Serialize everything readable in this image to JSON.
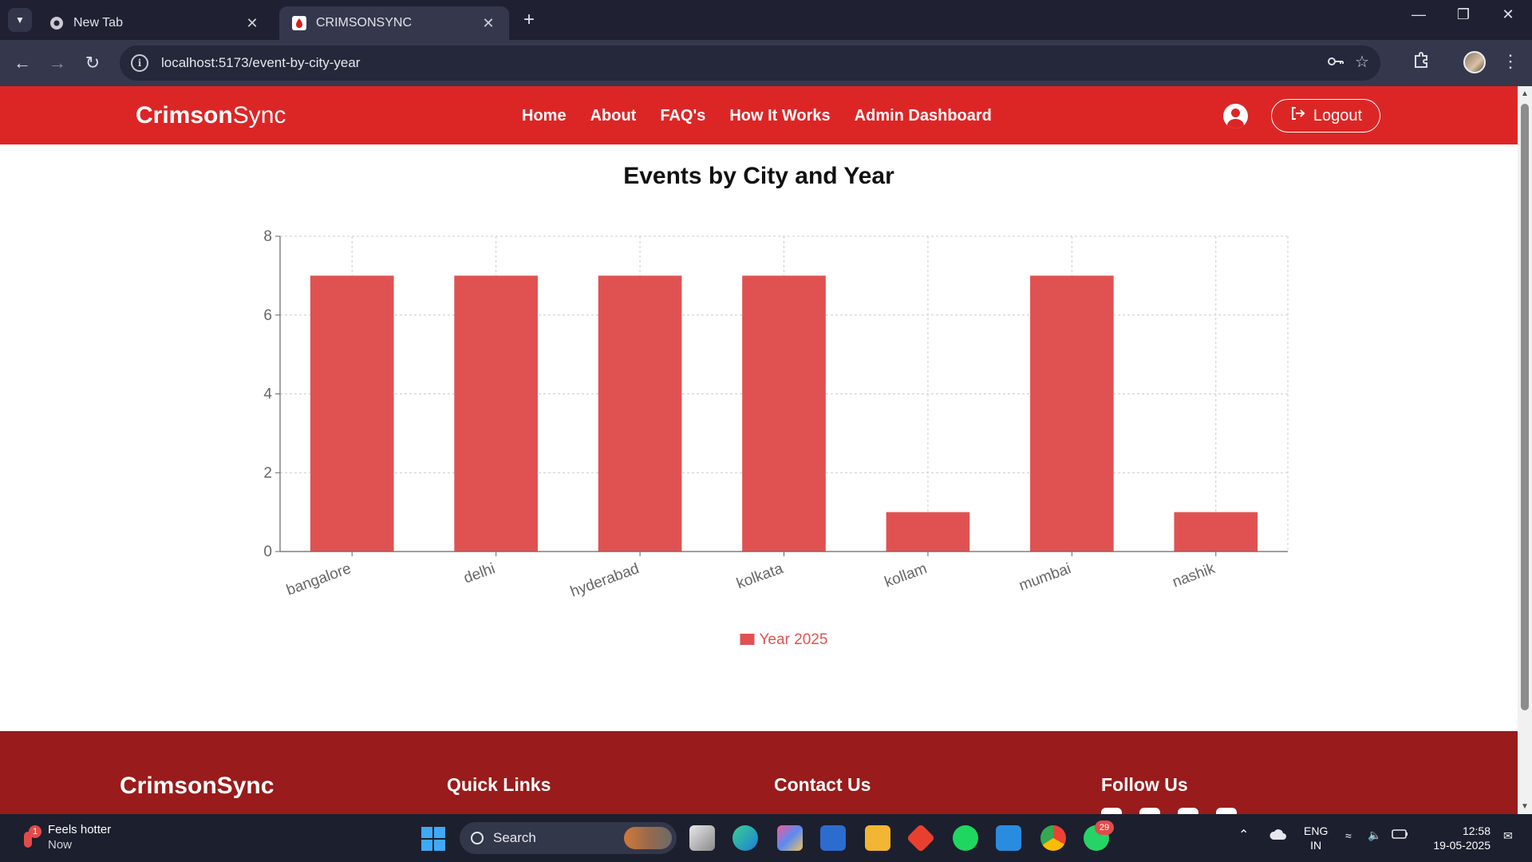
{
  "browser": {
    "tabs": [
      {
        "title": "New Tab",
        "icon": "chrome-icon",
        "active": false
      },
      {
        "title": "CRIMSONSYNC",
        "icon": "blood-drop-icon",
        "active": true
      }
    ],
    "url": "localhost:5173/event-by-city-year"
  },
  "header": {
    "brand_bold": "Crimson",
    "brand_light": "Sync",
    "nav": [
      "Home",
      "About",
      "FAQ's",
      "How It Works",
      "Admin Dashboard"
    ],
    "logout_label": "Logout"
  },
  "page": {
    "title": "Events by City and Year"
  },
  "chart_data": {
    "type": "bar",
    "categories": [
      "bangalore",
      "delhi",
      "hyderabad",
      "kolkata",
      "kollam",
      "mumbai",
      "nashik"
    ],
    "series": [
      {
        "name": "Year 2025",
        "values": [
          7,
          7,
          7,
          7,
          1,
          7,
          1
        ],
        "color": "#e05252"
      }
    ],
    "ylim": [
      0,
      8
    ],
    "yticks": [
      0,
      2,
      4,
      6,
      8
    ],
    "grid": true,
    "legend": "bottom-center",
    "xlabel": "",
    "ylabel": ""
  },
  "footer": {
    "brand": "CrimsonSync",
    "headings": [
      "Quick Links",
      "Contact Us",
      "Follow Us"
    ]
  },
  "taskbar": {
    "weather_title": "Feels hotter",
    "weather_sub": "Now",
    "weather_badge": "1",
    "search_label": "Search",
    "whatsapp_badge": "29",
    "lang_top": "ENG",
    "lang_bottom": "IN",
    "time": "12:58",
    "date": "19-05-2025"
  }
}
